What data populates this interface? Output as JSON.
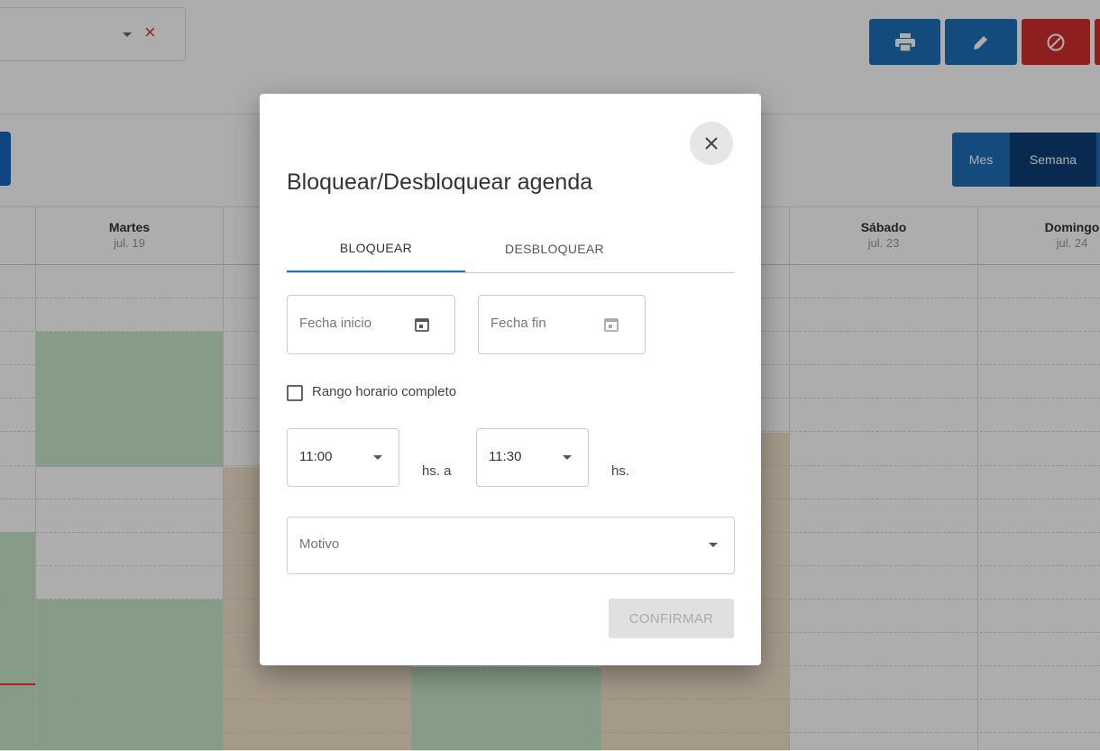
{
  "colors": {
    "primary_button": "#1e6fb8",
    "danger_button": "#d32f2f",
    "view_active": "#0d3f78",
    "view_inactive": "#1e6fb8",
    "tab_indicator": "#1976d2",
    "available_slot": "#c8e6c9",
    "occupied_slot": "#f3e3cc",
    "clear_icon": "#e53935"
  },
  "toolbar": {
    "print_icon": "printer-icon",
    "edit_icon": "pencil-icon",
    "block_icon": "ban-icon"
  },
  "view_switch": {
    "month_label": "Mes",
    "week_label": "Semana"
  },
  "calendar": {
    "days": [
      {
        "name": "Martes",
        "date": "jul. 19"
      },
      {
        "name": "Sábado",
        "date": "jul. 23"
      },
      {
        "name": "Domingo",
        "date": "jul. 24"
      }
    ]
  },
  "modal": {
    "title": "Bloquear/Desbloquear agenda",
    "tabs": [
      {
        "label": "BLOQUEAR",
        "active": true
      },
      {
        "label": "DESBLOQUEAR",
        "active": false
      }
    ],
    "start_date": {
      "placeholder": "Fecha inicio",
      "value": ""
    },
    "end_date": {
      "placeholder": "Fecha fin",
      "value": ""
    },
    "full_range": {
      "label": "Rango horario completo",
      "checked": false
    },
    "time_from": {
      "value": "11:00"
    },
    "time_from_unit": "hs. a",
    "time_to": {
      "value": "11:30"
    },
    "time_to_unit": "hs.",
    "reason": {
      "placeholder": "Motivo",
      "value": ""
    },
    "confirm_label": "CONFIRMAR"
  }
}
